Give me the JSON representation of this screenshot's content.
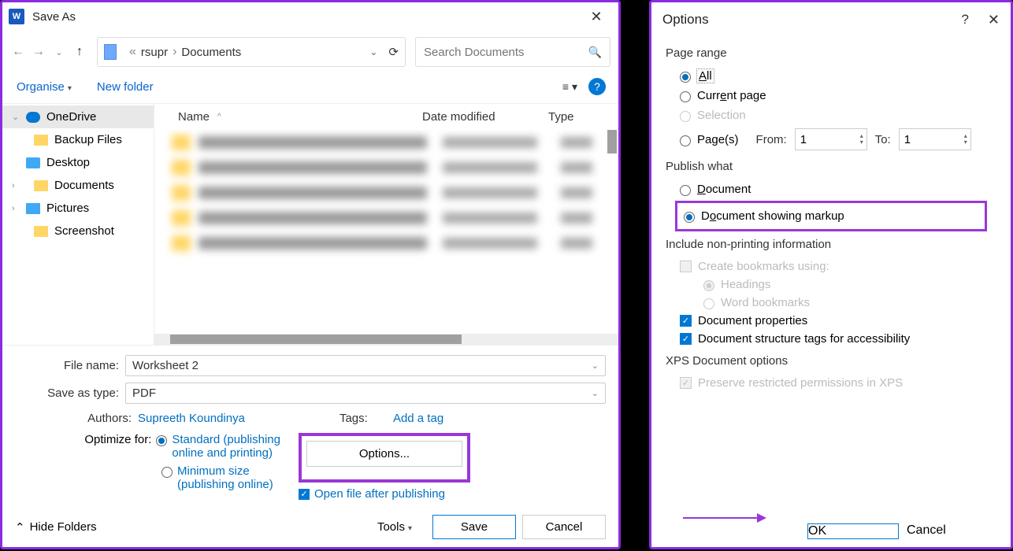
{
  "left": {
    "title": "Save As",
    "path": {
      "part1": "rsupr",
      "part2": "Documents"
    },
    "search_placeholder": "Search Documents",
    "toolbar": {
      "organise": "Organise",
      "new_folder": "New folder"
    },
    "columns": {
      "name": "Name",
      "date": "Date modified",
      "type": "Type"
    },
    "sidebar": {
      "onedrive": "OneDrive",
      "backup": "Backup Files",
      "desktop": "Desktop",
      "documents": "Documents",
      "pictures": "Pictures",
      "screenshot": "Screenshot"
    },
    "filename_label": "File name:",
    "filename_value": "Worksheet 2",
    "savetype_label": "Save as type:",
    "savetype_value": "PDF",
    "authors_label": "Authors:",
    "authors_value": "Supreeth Koundinya",
    "tags_label": "Tags:",
    "tags_value": "Add a tag",
    "optimize_label": "Optimize for:",
    "optimize_standard": "Standard (publishing online and printing)",
    "optimize_minimum": "Minimum size (publishing online)",
    "options_btn": "Options...",
    "open_after": "Open file after publishing",
    "hide_folders": "Hide Folders",
    "tools": "Tools",
    "save": "Save",
    "cancel": "Cancel"
  },
  "right": {
    "title": "Options",
    "page_range": {
      "title": "Page range",
      "all": "All",
      "current": "Current page",
      "selection": "Selection",
      "pages": "Page(s)",
      "from": "From:",
      "to": "To:",
      "from_val": "1",
      "to_val": "1"
    },
    "publish": {
      "title": "Publish what",
      "document": "Document",
      "markup": "Document showing markup"
    },
    "nonprint": {
      "title": "Include non-printing information",
      "bookmarks": "Create bookmarks using:",
      "headings": "Headings",
      "wordbm": "Word bookmarks",
      "docprops": "Document properties",
      "tags": "Document structure tags for accessibility"
    },
    "xps": {
      "title": "XPS Document options",
      "preserve": "Preserve restricted permissions in XPS"
    },
    "ok": "OK",
    "cancel": "Cancel"
  }
}
